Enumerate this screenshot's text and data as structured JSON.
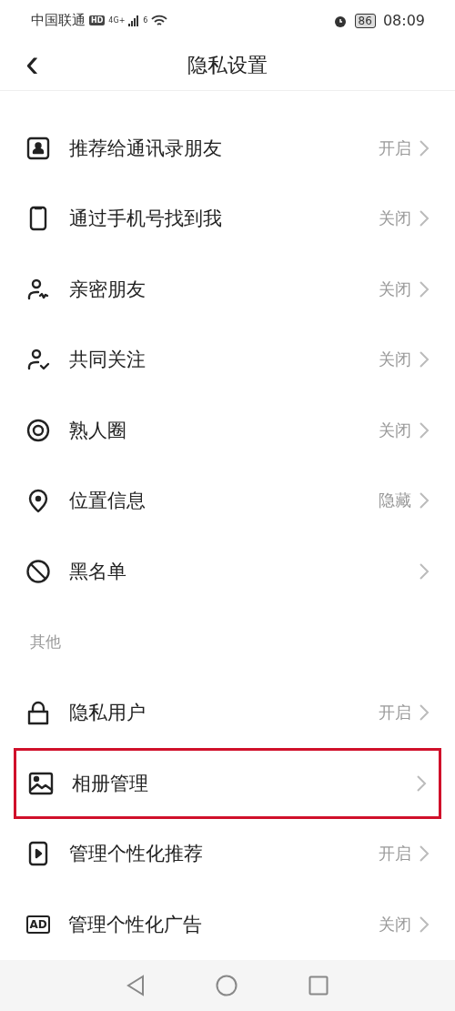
{
  "status_bar": {
    "carrier": "中国联通",
    "hd_badge": "HD",
    "network": "4G+",
    "wifi_label": "6",
    "battery": "86",
    "time": "08:09"
  },
  "header": {
    "back_icon": "‹",
    "title": "隐私设置"
  },
  "sections": [
    {
      "items": [
        {
          "kind": "contact-card",
          "label": "推荐给通讯录朋友",
          "value": "开启",
          "highlighted": false
        },
        {
          "kind": "phone",
          "label": "通过手机号找到我",
          "value": "关闭",
          "highlighted": false
        },
        {
          "kind": "person-spark",
          "label": "亲密朋友",
          "value": "关闭",
          "highlighted": false
        },
        {
          "kind": "person-check",
          "label": "共同关注",
          "value": "关闭",
          "highlighted": false
        },
        {
          "kind": "ring",
          "label": "熟人圈",
          "value": "关闭",
          "highlighted": false
        },
        {
          "kind": "location",
          "label": "位置信息",
          "value": "隐藏",
          "highlighted": false
        },
        {
          "kind": "block",
          "label": "黑名单",
          "highlighted": false
        }
      ]
    },
    {
      "title": "其他",
      "items": [
        {
          "kind": "lock",
          "label": "隐私用户",
          "value": "开启",
          "highlighted": false
        },
        {
          "kind": "image",
          "label": "相册管理",
          "highlighted": true
        },
        {
          "kind": "phone-play",
          "label": "管理个性化推荐",
          "value": "开启",
          "highlighted": false
        },
        {
          "kind": "ad",
          "icon_text": "AD",
          "label": "管理个性化广告",
          "value": "关闭",
          "highlighted": false
        }
      ]
    }
  ]
}
